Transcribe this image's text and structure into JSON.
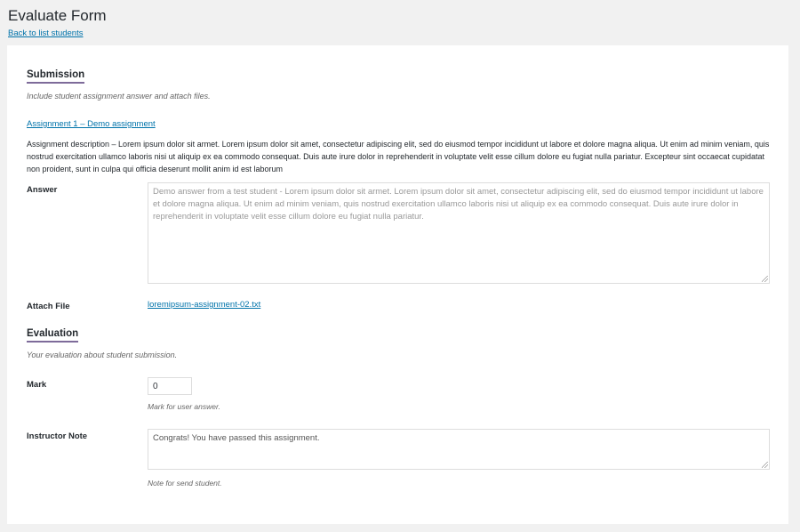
{
  "header": {
    "title": "Evaluate Form",
    "back_link": "Back to list students"
  },
  "submission": {
    "heading": "Submission",
    "description": "Include student assignment answer and attach files.",
    "assignment_link": "Assignment 1 – Demo assignment",
    "assignment_description": "Assignment description – Lorem ipsum dolor sit armet. Lorem ipsum dolor sit amet, consectetur adipiscing elit, sed do eiusmod tempor incididunt ut labore et dolore magna aliqua. Ut enim ad minim veniam, quis nostrud exercitation ullamco laboris nisi ut aliquip ex ea commodo consequat. Duis aute irure dolor in reprehenderit in voluptate velit esse cillum dolore eu fugiat nulla pariatur. Excepteur sint occaecat cupidatat non proident, sunt in culpa qui officia deserunt mollit anim id est laborum",
    "answer_label": "Answer",
    "answer_value": "Demo answer from a test student - Lorem ipsum dolor sit armet. Lorem ipsum dolor sit amet, consectetur adipiscing elit, sed do eiusmod tempor incididunt ut labore et dolore magna aliqua. Ut enim ad minim veniam, quis nostrud exercitation ullamco laboris nisi ut aliquip ex ea commodo consequat. Duis aute irure dolor in reprehenderit in voluptate velit esse cillum dolore eu fugiat nulla pariatur.",
    "attach_label": "Attach File",
    "attach_file": "loremipsum-assignment-02.txt"
  },
  "evaluation": {
    "heading": "Evaluation",
    "description": "Your evaluation about student submission.",
    "mark_label": "Mark",
    "mark_value": "0",
    "mark_hint": "Mark for user answer.",
    "note_label": "Instructor Note",
    "note_value": "Congrats! You have passed this assignment.",
    "note_hint": "Note for send student."
  },
  "colors": {
    "link": "#0073aa",
    "heading_underline": "#7e6b9a",
    "page_bg": "#f1f1f1",
    "panel_bg": "#ffffff"
  }
}
